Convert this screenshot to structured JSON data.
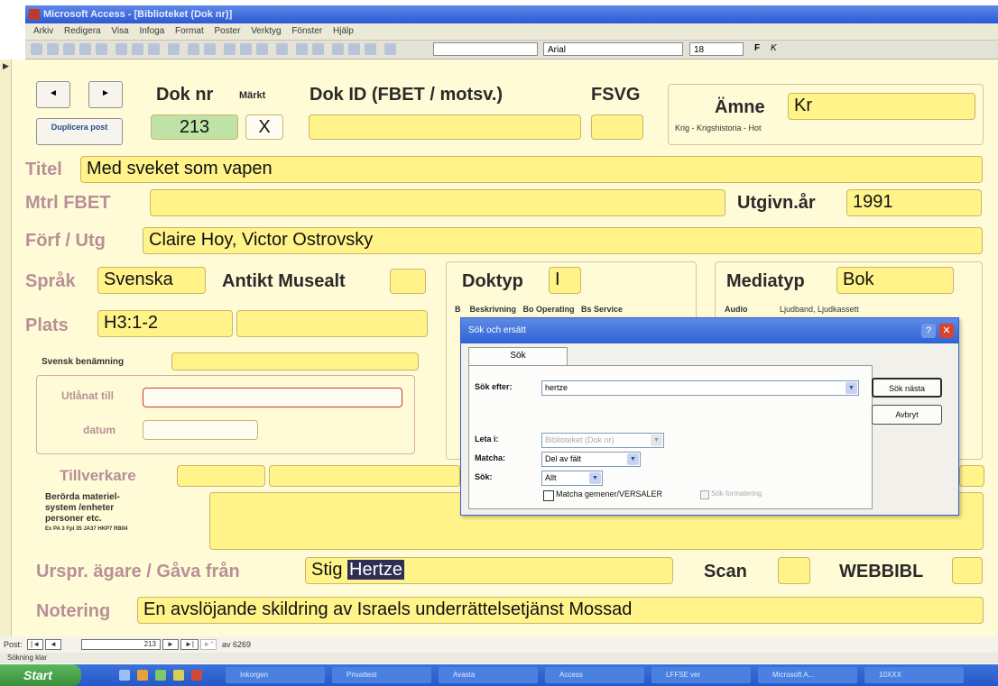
{
  "window": {
    "title": "Microsoft Access - [Biblioteket (Dok nr)]"
  },
  "menu": [
    "Arkiv",
    "Redigera",
    "Visa",
    "Infoga",
    "Format",
    "Poster",
    "Verktyg",
    "Fönster",
    "Hjälp"
  ],
  "toolbar": {
    "font": "Arial",
    "size": "18",
    "style_combo": ""
  },
  "nav": {
    "prev": "◄",
    "next": "►",
    "duplicate": "Duplicera post"
  },
  "header": {
    "dok_nr_label": "Dok nr",
    "dok_nr": "213",
    "markt_label": "Märkt",
    "markt": "X",
    "dok_id_label": "Dok ID (FBET / motsv.)",
    "dok_id": "",
    "fsvg_label": "FSVG",
    "fsvg": "",
    "amne_label": "Ämne",
    "amne": "Kr",
    "amne_desc": "Krig - Krigshistoria - Hot"
  },
  "fields": {
    "titel_label": "Titel",
    "titel": "Med sveket som vapen",
    "mtrl_label": "Mtrl FBET",
    "mtrl": "",
    "utgivn_label": "Utgivn.år",
    "utgivn": "1991",
    "forf_label": "Förf / Utg",
    "forf": "Claire Hoy, Victor Ostrovsky",
    "sprak_label": "Språk",
    "sprak": "Svenska",
    "antikt_label": "Antikt Musealt",
    "antikt": "",
    "doktyp_label": "Doktyp",
    "doktyp": "I",
    "doktyp_list": "B    Beskrivning   Bo Operating   Bs Service",
    "mediatyp_label": "Mediatyp",
    "mediatyp": "Bok",
    "media_list_audio": "Audio",
    "media_list_desc": "Ljudband, Ljudkassett",
    "plats_label": "Plats",
    "plats": "H3:1-2",
    "svensk_label": "Svensk benämning",
    "utlanat_label": "Utlånat till",
    "datum_label": "datum",
    "tillverkare_label": "Tillverkare",
    "berorda_label": "Berörda materiel-\nsystem /enheter\npersoner etc.",
    "berorda_sub": "Ex PA 3 Fpl 35 JA37 HKP7 RB04",
    "urspr_label": "Urspr. ägare / Gåva från",
    "urspr_prefix": "Stig",
    "urspr_highlight": "Hertze",
    "scan_label": "Scan",
    "webbibl_label": "WEBBIBL",
    "notering_label": "Notering",
    "notering": "En avslöjande skildring av Israels underrättelsetjänst Mossad"
  },
  "dialog": {
    "title": "Sök och ersätt",
    "tab": "Sök",
    "sok_efter_label": "Sök efter:",
    "sok_efter": "hertze",
    "leta_label": "Leta i:",
    "leta": "Biblioteket (Dok nr)",
    "matcha_label": "Matcha:",
    "matcha": "Del av fält",
    "sok_label": "Sök:",
    "sok": "Allt",
    "case_label": "Matcha gemener/VERSALER",
    "format_label": "Sök formatering",
    "find_next": "Sök nästa",
    "cancel": "Avbryt"
  },
  "record_nav": {
    "label": "Post:",
    "current": "213",
    "total_label": "av 6269"
  },
  "status": "Sökning klar",
  "taskbar": {
    "start": "Start",
    "items": [
      "Inkorgen",
      "Privattest",
      "Avasta",
      "Access",
      "LFFSE ver",
      "Microsoft A...",
      "10XXX"
    ]
  }
}
